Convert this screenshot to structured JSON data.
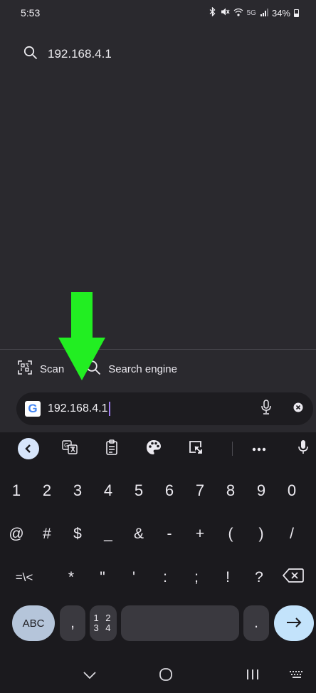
{
  "status_bar": {
    "time": "5:53",
    "network": "5G",
    "battery": "34%"
  },
  "suggestion": {
    "text": "192.168.4.1"
  },
  "tools": {
    "scan_label": "Scan",
    "search_engine_label": "Search engine"
  },
  "url_bar": {
    "value": "192.168.4.1"
  },
  "keyboard": {
    "number_row": [
      "1",
      "2",
      "3",
      "4",
      "5",
      "6",
      "7",
      "8",
      "9",
      "0"
    ],
    "symbol_row_1": [
      "@",
      "#",
      "$",
      "_",
      "&",
      "-",
      "+",
      "(",
      ")",
      "/"
    ],
    "symbol_row_2": [
      "=\\<",
      "*",
      "\"",
      "'",
      ":",
      ";",
      "!",
      "?"
    ],
    "abc_label": "ABC",
    "comma": ",",
    "numpad_label_top": "1 2",
    "numpad_label_bottom": "3 4",
    "period": "."
  },
  "colors": {
    "background": "#2a292e",
    "keyboard_bg": "#1b1a1e",
    "cursor": "#9f7cf0",
    "arrow": "#22ee22",
    "enter_key": "#c3e3fb",
    "abc_key": "#b5c5da"
  }
}
